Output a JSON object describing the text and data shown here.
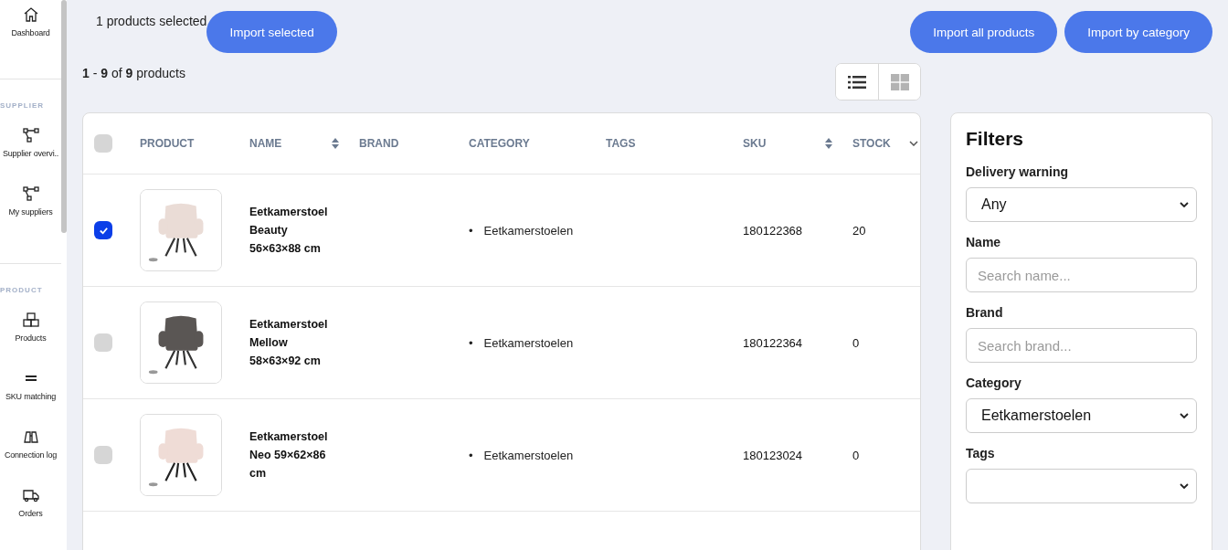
{
  "sidebar": {
    "sections": [
      {
        "items": [
          {
            "label": "Dashboard"
          }
        ]
      },
      {
        "heading": "SUPPLIER",
        "items": [
          {
            "label": "Supplier overvi.."
          },
          {
            "label": "My suppliers"
          }
        ]
      },
      {
        "heading": "PRODUCT",
        "items": [
          {
            "label": "Products"
          },
          {
            "label": "SKU matching"
          },
          {
            "label": "Connection log"
          },
          {
            "label": "Orders"
          }
        ]
      }
    ]
  },
  "selection": {
    "text": "1 products selected",
    "button": "Import selected"
  },
  "actions": [
    "Import all products",
    "Import by category"
  ],
  "result_count": "**1** - **9** of **9** products",
  "view_toggle": [
    {
      "kind": "list",
      "selected": true
    },
    {
      "kind": "grid",
      "selected": false
    }
  ],
  "table": {
    "all_checked": false,
    "columns": [
      {
        "label": "PRODUCT",
        "sortable": false
      },
      {
        "label": "NAME",
        "sortable": true
      },
      {
        "label": "BRAND",
        "sortable": false
      },
      {
        "label": "CATEGORY",
        "sortable": false
      },
      {
        "label": "TAGS",
        "sortable": false
      },
      {
        "label": "SKU",
        "sortable": true
      },
      {
        "label": "STOCK",
        "sortable": false
      }
    ],
    "rows": [
      {
        "checked": true,
        "image": {
          "kind": "picture"
        },
        "name": "Eetkamerstoel Beauty 56×63×88 cm",
        "categories": [
          {
            "bullet": "•",
            "label": "Eetkamerstoelen"
          }
        ],
        "sku": "180122368",
        "stock": "20"
      },
      {
        "checked": false,
        "image": {
          "kind": "picture"
        },
        "name": "Eetkamerstoel Mellow 58×63×92 cm",
        "categories": [
          {
            "bullet": "•",
            "label": "Eetkamerstoelen"
          }
        ],
        "sku": "180122364",
        "stock": "0"
      },
      {
        "checked": false,
        "image": {
          "kind": "picture"
        },
        "name": "Eetkamerstoel Neo 59×62×86 cm",
        "categories": [
          {
            "bullet": "•",
            "label": "Eetkamerstoelen"
          }
        ],
        "sku": "180123024",
        "stock": "0"
      }
    ]
  },
  "filters": {
    "title": "Filters",
    "fields": [
      {
        "label": "Delivery warning",
        "kind": "select",
        "value": "Any"
      },
      {
        "label": "Name",
        "kind": "input",
        "placeholder": "Search name..."
      },
      {
        "label": "Brand",
        "kind": "input",
        "placeholder": "Search brand..."
      },
      {
        "label": "Category",
        "kind": "select",
        "value": "Eetkamerstoelen"
      },
      {
        "label": "Tags",
        "kind": "select"
      }
    ]
  }
}
